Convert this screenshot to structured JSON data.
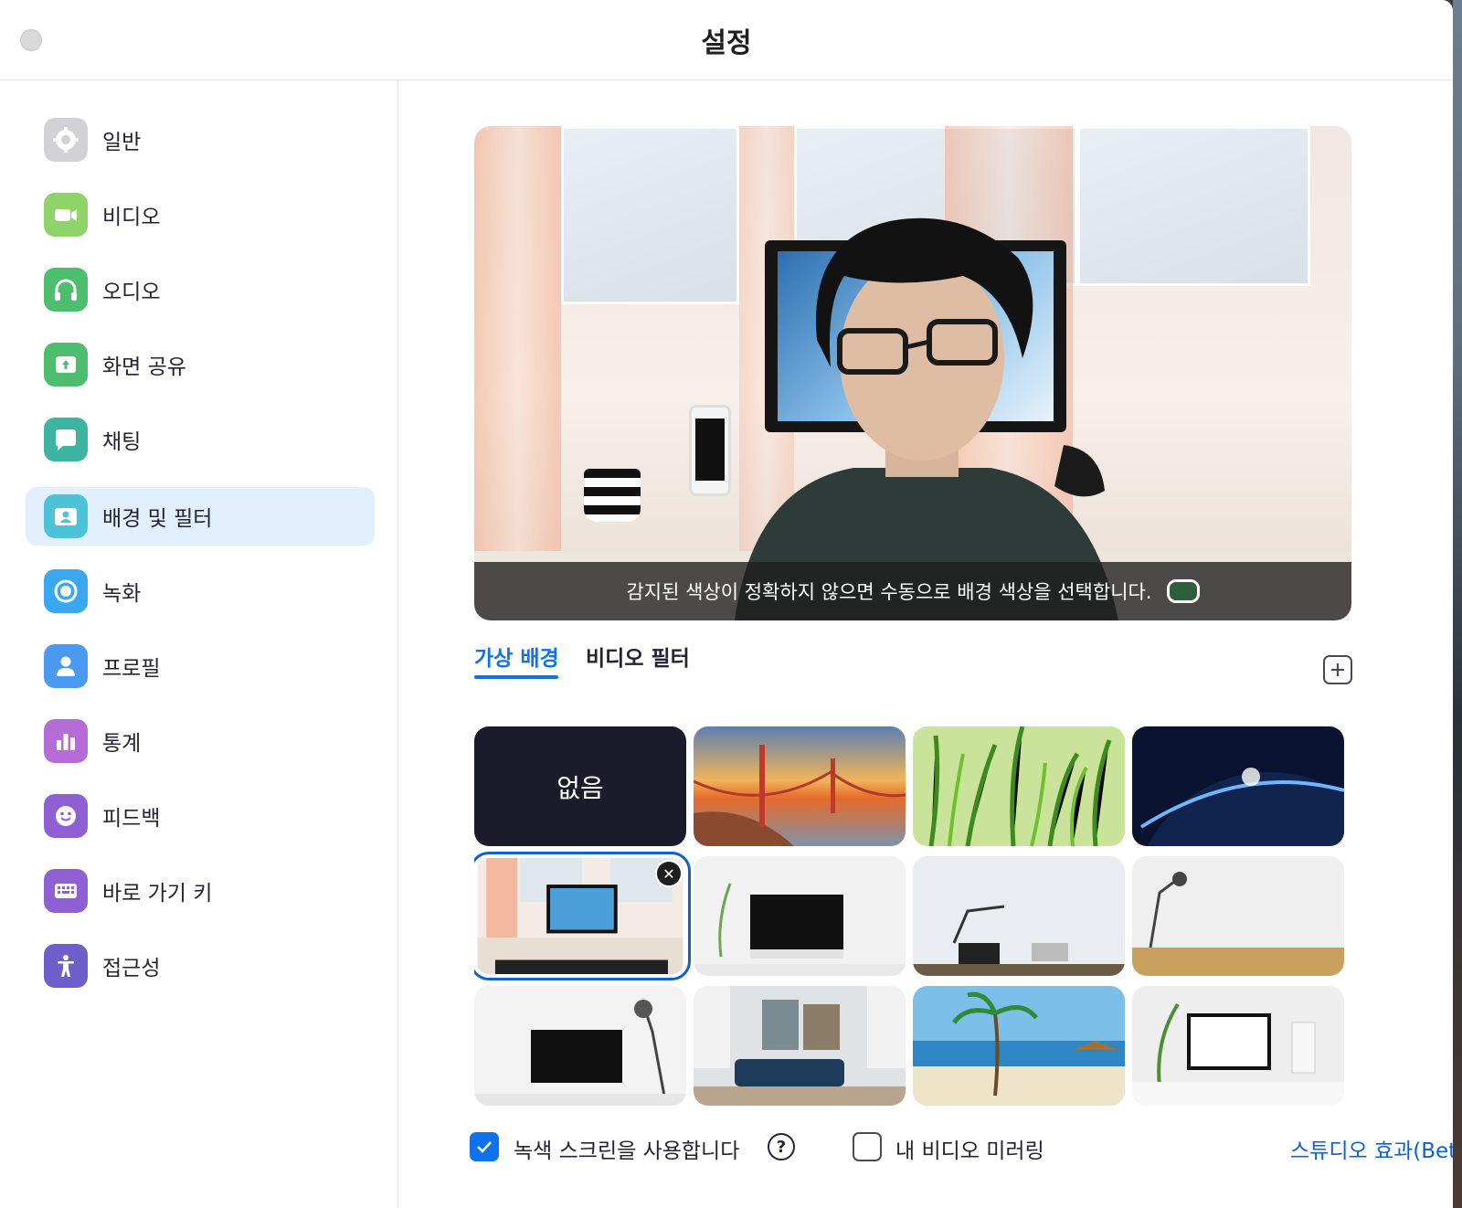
{
  "window": {
    "title": "설정"
  },
  "sidebar": {
    "items": [
      {
        "label": "일반",
        "icon": "gear-icon",
        "color": "#cfcfd3",
        "active": false
      },
      {
        "label": "비디오",
        "icon": "video-camera-icon",
        "color": "#8fd469",
        "active": false
      },
      {
        "label": "오디오",
        "icon": "headphones-icon",
        "color": "#4cbe6e",
        "active": false
      },
      {
        "label": "화면 공유",
        "icon": "share-screen-icon",
        "color": "#4cbe6e",
        "active": false
      },
      {
        "label": "채팅",
        "icon": "chat-bubble-icon",
        "color": "#3cb4a0",
        "active": false
      },
      {
        "label": "배경 및 필터",
        "icon": "background-portrait-icon",
        "color": "#4cc3d9",
        "active": true
      },
      {
        "label": "녹화",
        "icon": "record-icon",
        "color": "#3aa8f0",
        "active": false
      },
      {
        "label": "프로필",
        "icon": "profile-icon",
        "color": "#4b9af2",
        "active": false
      },
      {
        "label": "통계",
        "icon": "bar-chart-icon",
        "color": "#b56cd6",
        "active": false
      },
      {
        "label": "피드백",
        "icon": "smiley-icon",
        "color": "#8f5fd4",
        "active": false
      },
      {
        "label": "바로 가기 키",
        "icon": "keyboard-icon",
        "color": "#8f5fd4",
        "active": false
      },
      {
        "label": "접근성",
        "icon": "accessibility-icon",
        "color": "#6d5fc9",
        "active": false
      }
    ]
  },
  "preview": {
    "caption": "감지된 색상이 정확하지 않으면 수동으로 배경 색상을 선택합니다.",
    "swatch_color": "#2f5e3a"
  },
  "tabs": [
    {
      "label": "가상 배경",
      "active": true
    },
    {
      "label": "비디오 필터",
      "active": false
    }
  ],
  "backgrounds": {
    "none_label": "없음",
    "items": [
      "없음",
      "golden-gate",
      "grass",
      "earth-space",
      "desk-window",
      "white-imac",
      "desk-lamp",
      "wood-desk-lamp",
      "imac-lamp",
      "living-room",
      "beach",
      "plant-monitor"
    ],
    "selected": "desk-window"
  },
  "footer": {
    "green_screen_label": "녹색 스크린을 사용합니다",
    "green_screen_checked": true,
    "mirror_label": "내 비디오 미러링",
    "mirror_checked": false,
    "studio_link": "스튜디오 효과(Beta)"
  },
  "accent": "#0e72ed"
}
